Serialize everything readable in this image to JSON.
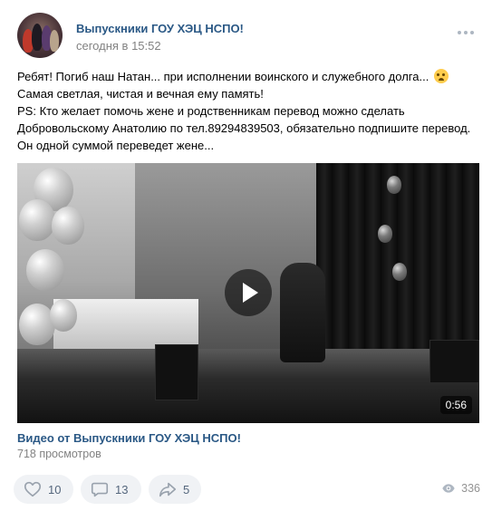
{
  "post": {
    "author": "Выпускники ГОУ ХЭЦ НСПО!",
    "time": "сегодня в 15:52",
    "lines": [
      "Ребят! Погиб наш Натан... при исполнении воинского и служебного долга...",
      "Самая светлая, чистая и вечная ему память!",
      "PS: Кто желает помочь жене и родственникам перевод можно сделать",
      "Добровольскому Анатолию по тел.89294839503, обязательно подпишите перевод.",
      "Он одной суммой переведет жене..."
    ],
    "emoji": "crying-face-icon"
  },
  "video": {
    "duration": "0:56",
    "title": "Видео от Выпускники ГОУ ХЭЦ НСПО!",
    "views": "718 просмотров"
  },
  "actions": {
    "likes": "10",
    "comments": "13",
    "shares": "5",
    "views": "336"
  },
  "colors": {
    "link": "#2a5885",
    "muted": "#828282",
    "pill": "#f0f2f5",
    "icon": "#99a2ad"
  }
}
